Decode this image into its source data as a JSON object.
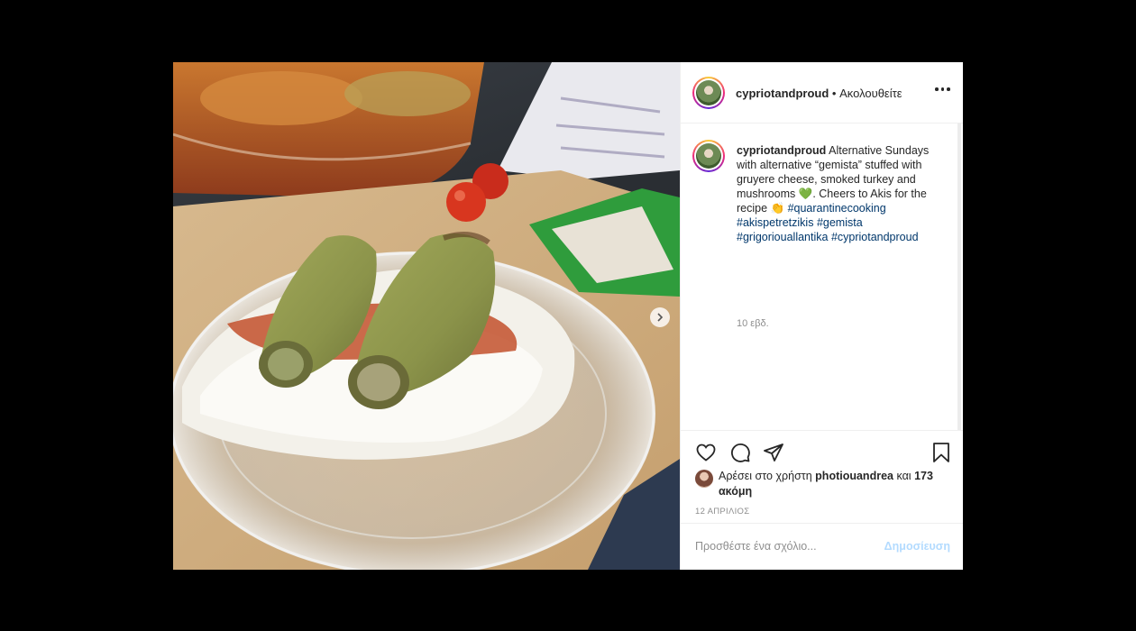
{
  "post": {
    "username": "cypriotandproud",
    "follow_state": "• Ακολουθείτε",
    "caption_text": "Alternative Sundays with alternative “gemista” stuffed with gruyere cheese, smoked turkey and mushrooms 💚. Cheers to Akis for the recipe 👏",
    "hashtags": [
      "#quarantinecooking",
      "#akispetretzikis",
      "#gemista",
      "#grigoriouallantika",
      "#cypriotandproud"
    ],
    "age": "10 εβδ.",
    "likes_prefix": "Αρέσει στο χρήστη",
    "likes_user": "photiouandrea",
    "likes_and": "και",
    "likes_count": "173 ακόμη",
    "date": "12 ΑΠΡΙΛΙΟΣ",
    "comment_placeholder": "Προσθέστε ένα σχόλιο...",
    "post_button": "Δημοσίευση"
  },
  "icons": {
    "heart": "heart-icon",
    "comment": "comment-icon",
    "share": "share-icon",
    "save": "bookmark-icon",
    "more": "more-options-icon",
    "next": "chevron-right-icon"
  },
  "colors": {
    "hashtag": "#00376b",
    "post_button_disabled": "#b3dbff",
    "secondary_text": "#8e8e8e"
  }
}
